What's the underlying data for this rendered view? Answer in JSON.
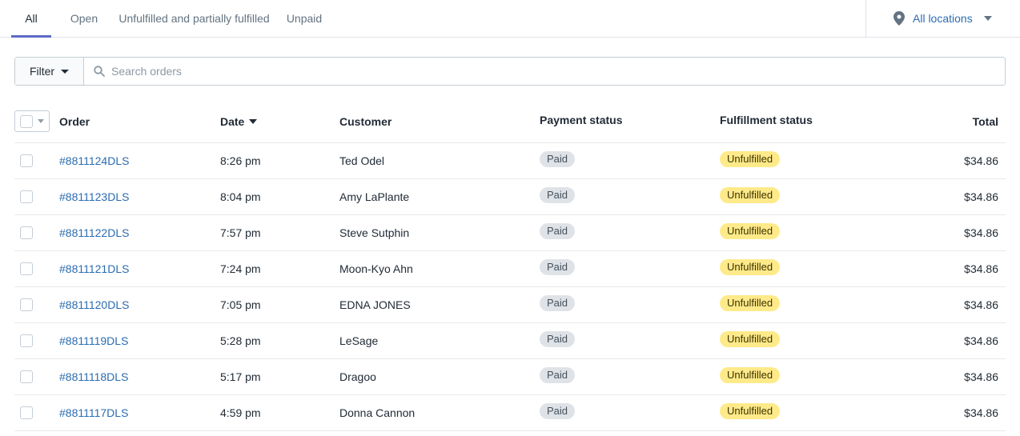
{
  "tabs": [
    {
      "label": "All",
      "active": true
    },
    {
      "label": "Open",
      "active": false
    },
    {
      "label": "Unfulfilled and partially fulfilled",
      "active": false
    },
    {
      "label": "Unpaid",
      "active": false
    }
  ],
  "locations": {
    "label": "All locations",
    "icon": "map-pin-icon"
  },
  "search": {
    "filter_label": "Filter",
    "placeholder": "Search orders",
    "value": ""
  },
  "table": {
    "columns": {
      "order": "Order",
      "date": "Date",
      "customer": "Customer",
      "payment": "Payment status",
      "fulfillment": "Fulfillment status",
      "total": "Total"
    },
    "rows": [
      {
        "order": "#8811124DLS",
        "date": "8:26 pm",
        "customer": "Ted Odel",
        "payment": "Paid",
        "fulfillment": "Unfulfilled",
        "total": "$34.86"
      },
      {
        "order": "#8811123DLS",
        "date": "8:04 pm",
        "customer": "Amy LaPlante",
        "payment": "Paid",
        "fulfillment": "Unfulfilled",
        "total": "$34.86"
      },
      {
        "order": "#8811122DLS",
        "date": "7:57 pm",
        "customer": "Steve Sutphin",
        "payment": "Paid",
        "fulfillment": "Unfulfilled",
        "total": "$34.86"
      },
      {
        "order": "#8811121DLS",
        "date": "7:24 pm",
        "customer": "Moon-Kyo Ahn",
        "payment": "Paid",
        "fulfillment": "Unfulfilled",
        "total": "$34.86"
      },
      {
        "order": "#8811120DLS",
        "date": "7:05 pm",
        "customer": "EDNA JONES",
        "payment": "Paid",
        "fulfillment": "Unfulfilled",
        "total": "$34.86"
      },
      {
        "order": "#8811119DLS",
        "date": "5:28 pm",
        "customer": "LeSage",
        "payment": "Paid",
        "fulfillment": "Unfulfilled",
        "total": "$34.86"
      },
      {
        "order": "#8811118DLS",
        "date": "5:17 pm",
        "customer": "Dragoo",
        "payment": "Paid",
        "fulfillment": "Unfulfilled",
        "total": "$34.86"
      },
      {
        "order": "#8811117DLS",
        "date": "4:59 pm",
        "customer": "Donna Cannon",
        "payment": "Paid",
        "fulfillment": "Unfulfilled",
        "total": "$34.86"
      }
    ]
  },
  "colors": {
    "accent": "#5c6ac4",
    "link": "#2b6cb0",
    "paid_badge": "#dfe3e8",
    "unfulfilled_badge": "#ffea8a"
  }
}
